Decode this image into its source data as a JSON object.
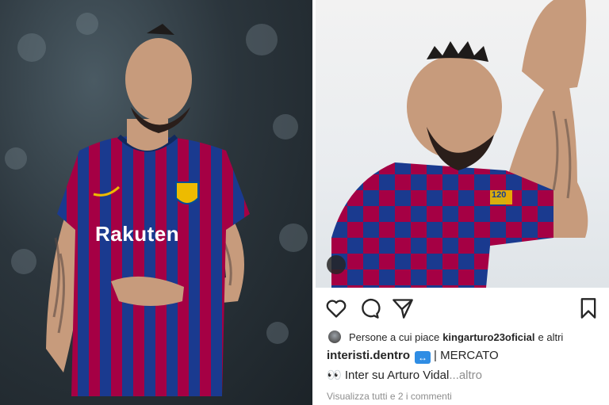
{
  "left_photo": {
    "shirt_sponsor": "Rakuten",
    "sponsor_sub": "Rakuten",
    "crest_colors": [
      "#a50044",
      "#004d98",
      "#edbb00"
    ],
    "shirt_colors": {
      "stripe_red": "#a50044",
      "stripe_blue": "#1a3a8f"
    },
    "jersey_brand_mark": "✓"
  },
  "right_photo": {
    "sleeve_text": "120",
    "shirt_colors": {
      "red": "#a50044",
      "blue": "#1a3a8f"
    }
  },
  "instagram": {
    "icons": {
      "like": "heart-icon",
      "comment": "comment-icon",
      "share": "send-icon",
      "save": "bookmark-icon"
    },
    "likes": {
      "prefix": "Persone a cui piace",
      "user": "kingarturo23oficial",
      "suffix": "e altri"
    },
    "caption": {
      "username": "interisti.dentro",
      "badge_glyph": "↔",
      "text": "| MERCATO"
    },
    "caption_line2": {
      "emoji": "👀",
      "text": "Inter su Arturo Vidal",
      "more": "...altro"
    },
    "view_comments": "Visualizza tutti e 2 i commenti"
  },
  "colors": {
    "text": "#262626",
    "muted": "#8e8e8e",
    "badge_blue": "#2f8de4"
  }
}
